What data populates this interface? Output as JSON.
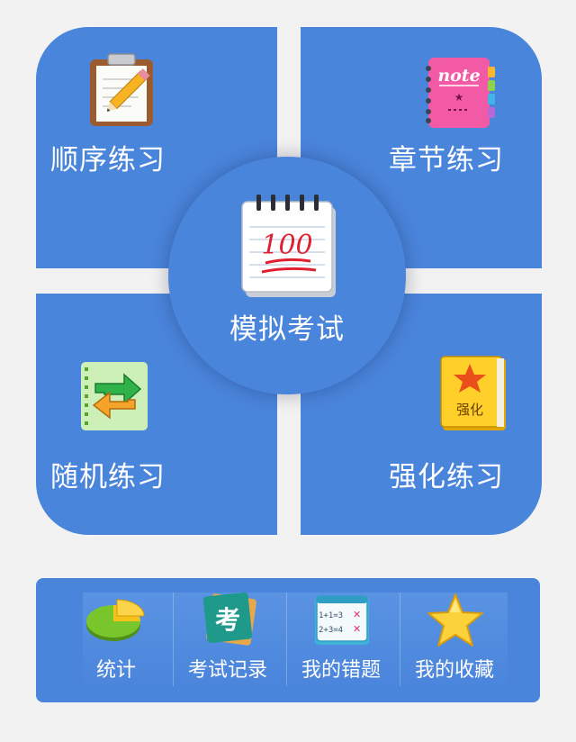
{
  "tiles": {
    "sequential": {
      "label": "顺序练习",
      "icon": "clipboard-pencil-icon"
    },
    "chapter": {
      "label": "章节练习",
      "icon": "notebook-icon",
      "icon_text": "note"
    },
    "random": {
      "label": "随机练习",
      "icon": "shuffle-arrows-icon"
    },
    "intensive": {
      "label": "强化练习",
      "icon": "book-star-icon",
      "icon_text": "强化"
    }
  },
  "center": {
    "label": "模拟考试",
    "icon": "notepad-100-icon",
    "icon_text": "100"
  },
  "bottom_bar": {
    "items": [
      {
        "label": "统计",
        "icon": "pie-chart-icon"
      },
      {
        "label": "考试记录",
        "icon": "exam-card-icon",
        "icon_text": "考"
      },
      {
        "label": "我的错题",
        "icon": "wrong-answers-icon",
        "icon_text_1": "1+1=3",
        "icon_text_2": "2+3=4"
      },
      {
        "label": "我的收藏",
        "icon": "star-icon"
      }
    ]
  },
  "colors": {
    "tile_blue": "#4a85dc",
    "background": "#f2f2f2"
  }
}
